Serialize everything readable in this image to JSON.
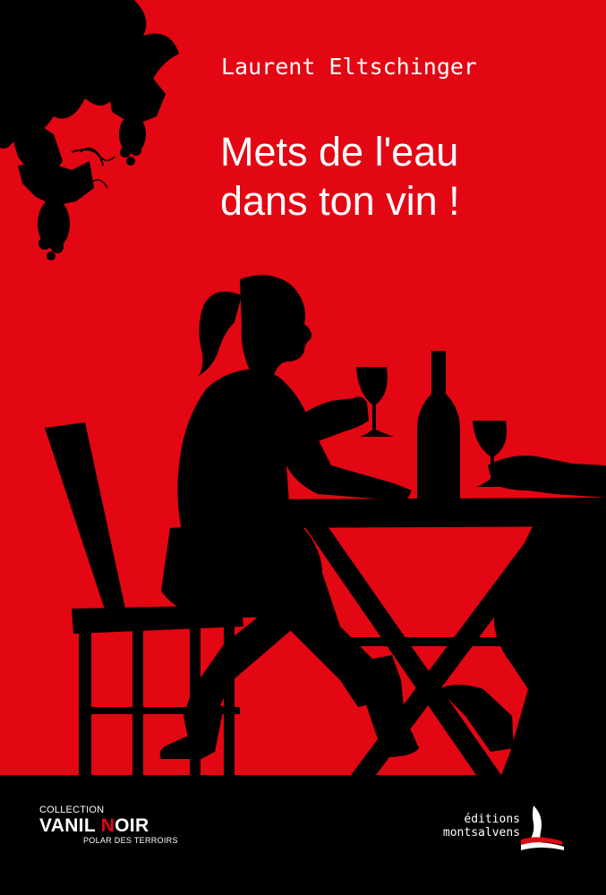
{
  "book": {
    "author": "Laurent Eltschinger",
    "title_line1": "Mets de l'eau",
    "title_line2": "dans ton vin !"
  },
  "collection": {
    "label": "COLLECTION",
    "name_part1": "VANIL ",
    "name_accent": "N",
    "name_part2": "OIR",
    "subtitle": "POLAR DES TERROIRS"
  },
  "publisher": {
    "line1": "éditions",
    "line2": "montsalvens"
  },
  "colors": {
    "background": "#e30613",
    "silhouette": "#000000",
    "text": "#ffffff",
    "accent": "#e30613"
  }
}
